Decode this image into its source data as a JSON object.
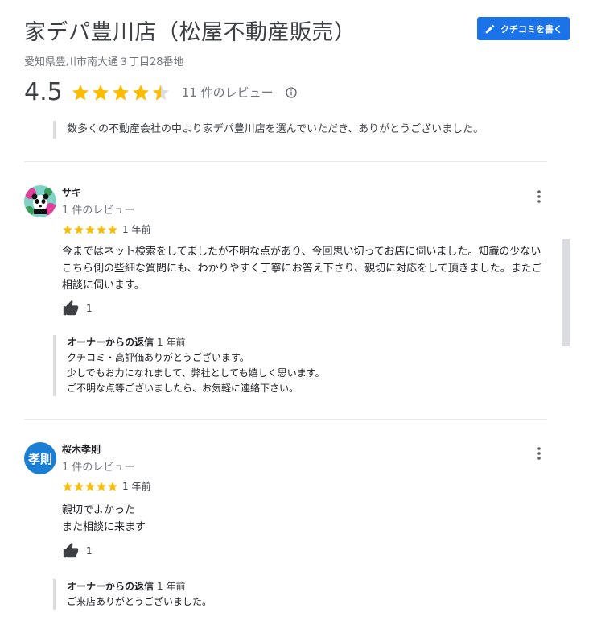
{
  "business": {
    "name": "家デパ豊川店（松屋不動産販売）",
    "address": "愛知県豊川市南大通３丁目28番地",
    "rating": "4.5",
    "review_count": "11 件のレビュー",
    "write_review_label": "クチコミを書く",
    "summary": "数多くの不動産会社の中より家デパ豊川店を選んでいただき、ありがとうございました。"
  },
  "colors": {
    "accent": "#1a73e8",
    "star": "#fbbc04",
    "star_empty": "#dadce0"
  },
  "reviews": [
    {
      "name": "サキ",
      "count": "1 件のレビュー",
      "stars": 5,
      "date": "1 年前",
      "text": "今まではネット検索をしてましたが不明な点があり、今回思い切ってお店に伺いました。知識の少ないこちら側の些細な質問にも、わかりやすく丁寧にお答え下さり、親切に対応をして頂きました。またご相談に伺います。",
      "likes": "1",
      "owner_label": "オーナーからの返信",
      "owner_date": "1 年前",
      "owner_lines": [
        "クチコミ・高評価ありがとうございます。",
        "少しでもお力になれまして、弊社としても嬉しく思います。",
        "ご不明な点等ございましたら、お気軽に連絡下さい。"
      ]
    },
    {
      "name": "桜木孝則",
      "avatar_text": "孝則",
      "count": "1 件のレビュー",
      "stars": 5,
      "date": "1 年前",
      "text_lines": [
        "親切でよかった",
        "また相談に来ます"
      ],
      "likes": "1",
      "owner_label": "オーナーからの返信",
      "owner_date": "1 年前",
      "owner_lines": [
        "ご来店ありがとうございました。"
      ]
    }
  ]
}
